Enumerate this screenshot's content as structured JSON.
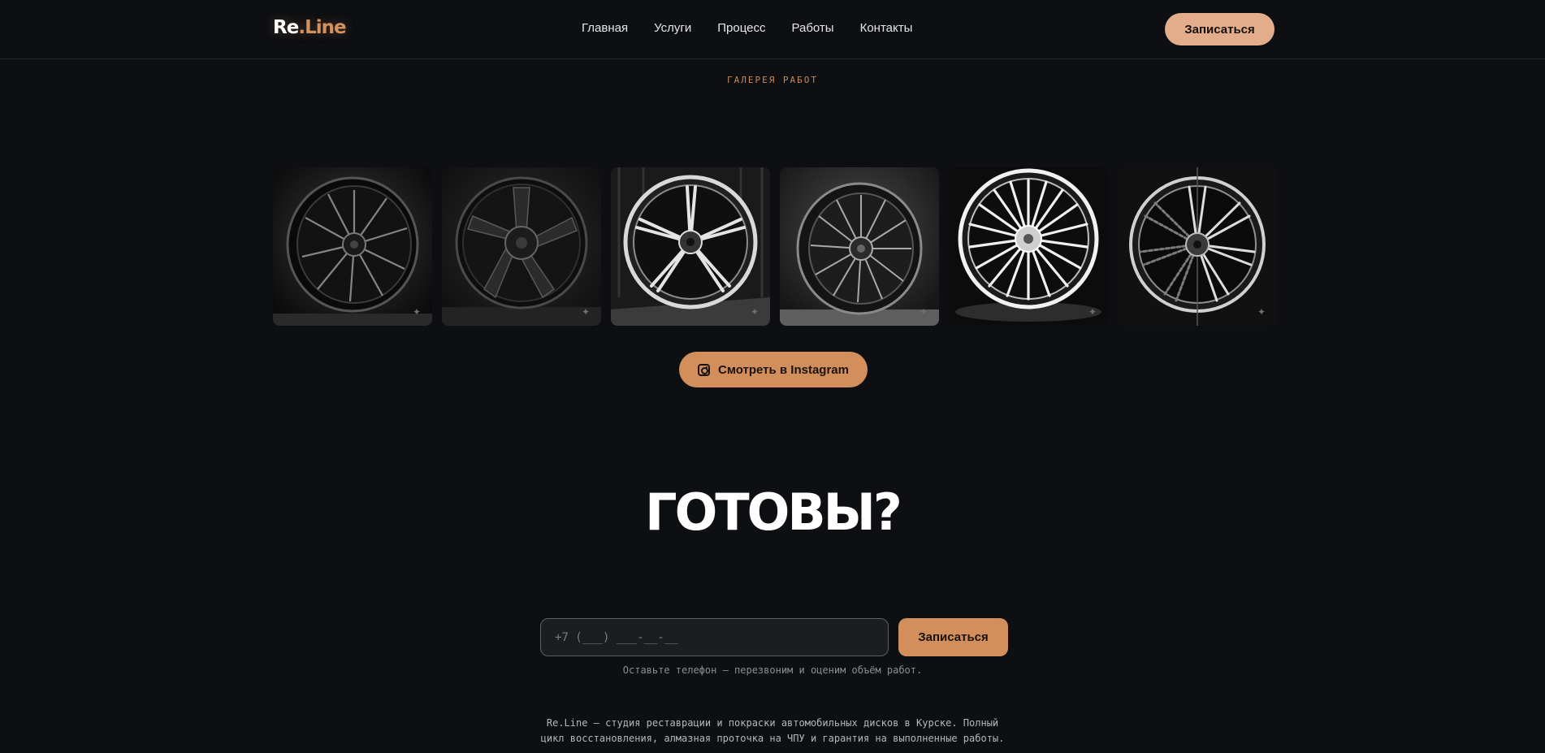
{
  "header": {
    "logo_main": "Re",
    "logo_dot": ".",
    "logo_accent": "Line",
    "nav": [
      "Главная",
      "Услуги",
      "Процесс",
      "Работы",
      "Контакты"
    ],
    "cta_label": "Записаться"
  },
  "gallery": {
    "label": "ГАЛЕРЕЯ РАБОТ",
    "tiles": [
      {
        "alt": "black-mesh-wheel"
      },
      {
        "alt": "black-five-spoke-wheel"
      },
      {
        "alt": "silver-split-spoke-wheel"
      },
      {
        "alt": "dark-mesh-wheel"
      },
      {
        "alt": "silver-multi-spoke-wheel"
      },
      {
        "alt": "half-restored-wheel"
      }
    ],
    "instagram_label": "Смотреть в Instagram"
  },
  "cta": {
    "title": "ГОТОВЫ?",
    "phone_placeholder": "+7 (___) ___-__-__",
    "submit_label": "Записаться",
    "hint": "Оставьте телефон — перезвоним и оценим объём работ."
  },
  "about": {
    "line1": "Re.Line — студия реставрации и покраски автомобильных дисков в Курске. Полный",
    "line2": "цикл восстановления, алмазная проточка на ЧПУ и гарантия на выполненные работы."
  },
  "colors": {
    "background": "#0d0f12",
    "accent": "#d28f5c",
    "accent_light": "#e3ac8a"
  }
}
